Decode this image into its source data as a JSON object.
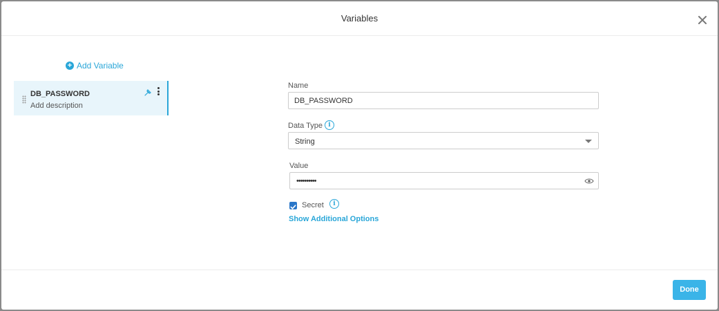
{
  "dialog": {
    "title": "Variables",
    "close_icon": "close-icon"
  },
  "sidebar": {
    "add_variable_label": "Add Variable",
    "items": [
      {
        "name": "DB_PASSWORD",
        "description_placeholder": "Add description",
        "selected": true
      }
    ]
  },
  "form": {
    "name_label": "Name",
    "name_value": "DB_PASSWORD",
    "data_type_label": "Data Type",
    "data_type_value": "String",
    "value_label": "Value",
    "value_masked": "••••••••••",
    "secret_label": "Secret",
    "secret_checked": true,
    "show_additional_options": "Show Additional Options"
  },
  "footer": {
    "done_label": "Done"
  },
  "colors": {
    "accent": "#29a6d8",
    "selected_bg": "#e8f5fb",
    "done_bg": "#3ab4e8",
    "checkbox": "#2a76c8"
  }
}
